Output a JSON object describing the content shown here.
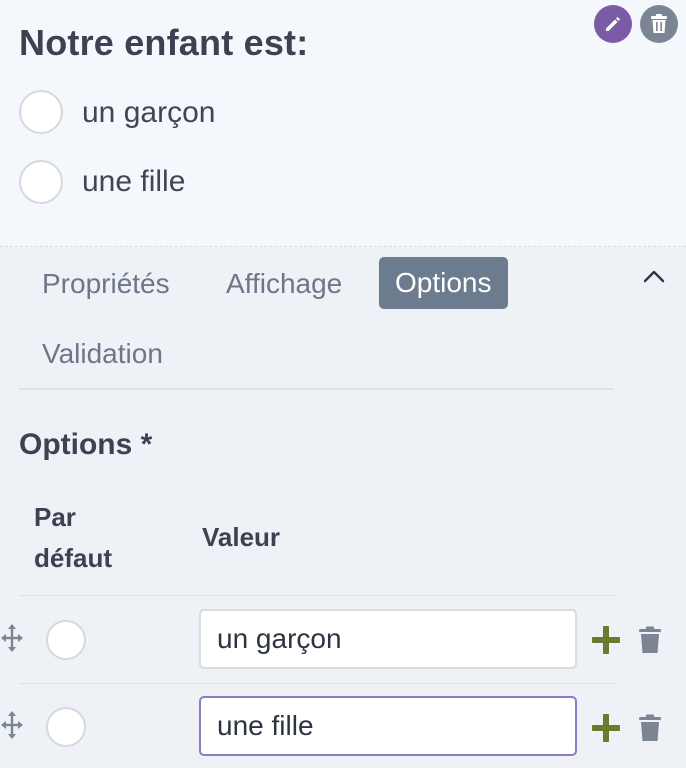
{
  "question": {
    "title": "Notre enfant est:",
    "choices": [
      {
        "label": "un garçon"
      },
      {
        "label": "une fille"
      }
    ],
    "tools": {
      "edit_icon": "pencil-icon",
      "delete_icon": "trash-icon",
      "edit_color": "#7b5aa6"
    }
  },
  "tabs": {
    "items": [
      {
        "label": "Propriétés"
      },
      {
        "label": "Affichage"
      },
      {
        "label": "Options",
        "active": true
      },
      {
        "label": "Validation"
      }
    ],
    "collapse_icon": "chevron-up-icon"
  },
  "options_section": {
    "title": "Options *",
    "headers": {
      "default_line1": "Par",
      "default_line2": "défaut",
      "value": "Valeur"
    },
    "rows": [
      {
        "value": "un garçon",
        "focused": false
      },
      {
        "value": "une fille",
        "focused": true
      }
    ],
    "colors": {
      "add": "#6b7a2f",
      "delete": "#7b8593",
      "focus_border": "#8e7cc3"
    }
  }
}
